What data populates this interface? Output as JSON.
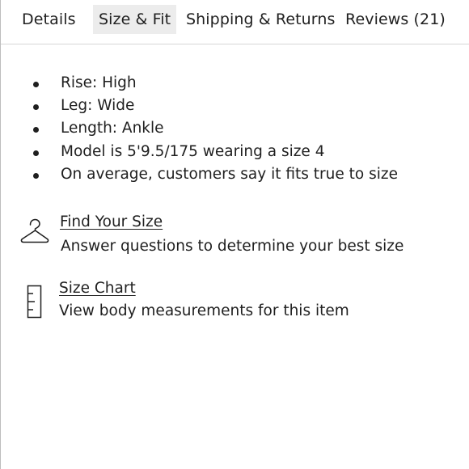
{
  "tabs": [
    {
      "label": "Details",
      "active": false
    },
    {
      "label": "Size & Fit",
      "active": true
    },
    {
      "label": "Shipping & Returns",
      "active": false
    },
    {
      "label": "Reviews (21)",
      "active": false
    }
  ],
  "features": [
    "Rise: High",
    "Leg: Wide",
    "Length: Ankle",
    "Model is 5'9.5/175 wearing a size 4",
    "On average, customers say it fits true to size"
  ],
  "find_your_size": {
    "icon": "hanger-icon",
    "link": "Find Your Size",
    "description": "Answer questions to determine your best size"
  },
  "size_chart": {
    "icon": "ruler-icon",
    "link": "Size Chart",
    "description": "View body measurements for this item"
  },
  "colors": {
    "text": "#1f1f1f",
    "active_tab_bg": "#ececec",
    "divider": "#d6d6d6"
  }
}
